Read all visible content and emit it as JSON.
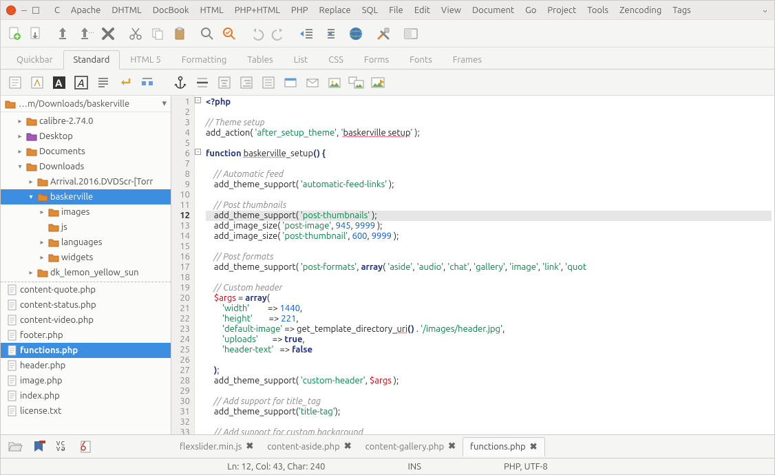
{
  "menu": [
    "C",
    "Apache",
    "DHTML",
    "DocBook",
    "HTML",
    "PHP+HTML",
    "PHP",
    "Replace",
    "SQL",
    "File",
    "Edit",
    "View",
    "Document",
    "Go",
    "Project",
    "Tools",
    "Zencoding",
    "Tags"
  ],
  "toolTabs": [
    "Quickbar",
    "Standard",
    "HTML 5",
    "Formatting",
    "Tables",
    "List",
    "CSS",
    "Forms",
    "Fonts",
    "Frames"
  ],
  "activeToolTab": 1,
  "breadcrumb": "…m/Downloads/baskerville",
  "tree": [
    {
      "label": "calibre-2.74.0",
      "icon": "folder",
      "indent": 1,
      "exp": "▸"
    },
    {
      "label": "Desktop",
      "icon": "folder-p",
      "indent": 1,
      "exp": "▸"
    },
    {
      "label": "Documents",
      "icon": "folder-d",
      "indent": 1,
      "exp": "▸"
    },
    {
      "label": "Downloads",
      "icon": "folder-d",
      "indent": 1,
      "exp": "▾"
    },
    {
      "label": "Arrival.2016.DVDScr-[Torr",
      "icon": "folder",
      "indent": 2,
      "exp": "▸"
    },
    {
      "label": "baskerville",
      "icon": "folder",
      "indent": 2,
      "exp": "▾",
      "sel": true
    },
    {
      "label": "images",
      "icon": "folder",
      "indent": 3,
      "exp": "▸"
    },
    {
      "label": "js",
      "icon": "folder",
      "indent": 3,
      "exp": ""
    },
    {
      "label": "languages",
      "icon": "folder",
      "indent": 3,
      "exp": "▸"
    },
    {
      "label": "widgets",
      "icon": "folder",
      "indent": 3,
      "exp": "▸"
    },
    {
      "label": "dk_lemon_yellow_sun",
      "icon": "folder",
      "indent": 2,
      "exp": "▸"
    }
  ],
  "files": [
    "content-quote.php",
    "content-status.php",
    "content-video.php",
    "footer.php",
    "functions.php",
    "header.php",
    "image.php",
    "index.php",
    "license.txt"
  ],
  "selectedFile": 4,
  "openTabs": [
    {
      "label": "flexslider.min.js",
      "dirty": true
    },
    {
      "label": "content-aside.php",
      "dirty": true
    },
    {
      "label": "content-gallery.php",
      "dirty": true
    },
    {
      "label": "functions.php",
      "dirty": true
    }
  ],
  "activeOpenTab": 3,
  "status": {
    "pos": "Ln: 12, Col: 43, Char: 240",
    "ins": "INS",
    "mode": "PHP, UTF-8"
  },
  "lines": 33,
  "currentLine": 12,
  "code": [
    {
      "t": [
        [
          "k",
          "<?php"
        ]
      ]
    },
    {
      "t": []
    },
    {
      "t": [
        [
          "c",
          "// Theme setup"
        ]
      ]
    },
    {
      "t": [
        [
          "p",
          "add_action("
        ],
        [
          "p",
          " "
        ],
        [
          "s",
          "'after_setup_theme'"
        ],
        [
          "p",
          ", "
        ],
        [
          "s",
          "'"
        ],
        [
          "f",
          "baskerville setup"
        ],
        [
          "s",
          "'"
        ],
        [
          "p",
          " );"
        ]
      ]
    },
    {
      "t": []
    },
    {
      "t": [
        [
          "k",
          "function"
        ],
        [
          "p",
          " "
        ],
        [
          "f",
          "baskerville"
        ],
        [
          "p",
          "_setup"
        ],
        [
          "k",
          "()"
        ],
        [
          "p",
          " "
        ],
        [
          "k",
          "{"
        ]
      ]
    },
    {
      "t": []
    },
    {
      "t": [
        [
          "p",
          "    "
        ],
        [
          "c",
          "// Automatic feed"
        ]
      ]
    },
    {
      "t": [
        [
          "p",
          "    add_theme_support( "
        ],
        [
          "s",
          "'automatic-feed-links'"
        ],
        [
          "p",
          " );"
        ]
      ]
    },
    {
      "t": []
    },
    {
      "t": [
        [
          "p",
          "    "
        ],
        [
          "c",
          "// Post thumbnails"
        ]
      ]
    },
    {
      "t": [
        [
          "p",
          "    add_theme_support( "
        ],
        [
          "s",
          "'post-thumbnails'"
        ],
        [
          "p",
          " );"
        ]
      ],
      "hl": true
    },
    {
      "t": [
        [
          "p",
          "    add_image_size( "
        ],
        [
          "s",
          "'post-image'"
        ],
        [
          "p",
          ", "
        ],
        [
          "n",
          "945"
        ],
        [
          "p",
          ", "
        ],
        [
          "n",
          "9999"
        ],
        [
          "p",
          " );"
        ]
      ]
    },
    {
      "t": [
        [
          "p",
          "    add_image_size( "
        ],
        [
          "s",
          "'post-thumbnail'"
        ],
        [
          "p",
          ", "
        ],
        [
          "n",
          "600"
        ],
        [
          "p",
          ", "
        ],
        [
          "n",
          "9999"
        ],
        [
          "p",
          " );"
        ]
      ]
    },
    {
      "t": []
    },
    {
      "t": [
        [
          "p",
          "    "
        ],
        [
          "c",
          "// Post formats"
        ]
      ]
    },
    {
      "t": [
        [
          "p",
          "    add_theme_support( "
        ],
        [
          "s",
          "'post-formats'"
        ],
        [
          "p",
          ", "
        ],
        [
          "k",
          "array"
        ],
        [
          "p",
          "( "
        ],
        [
          "s",
          "'aside'"
        ],
        [
          "p",
          ", "
        ],
        [
          "s",
          "'audio'"
        ],
        [
          "p",
          ", "
        ],
        [
          "s",
          "'chat'"
        ],
        [
          "p",
          ", "
        ],
        [
          "s",
          "'gallery'"
        ],
        [
          "p",
          ", "
        ],
        [
          "s",
          "'image'"
        ],
        [
          "p",
          ", "
        ],
        [
          "s",
          "'link'"
        ],
        [
          "p",
          ", "
        ],
        [
          "s",
          "'quot"
        ]
      ]
    },
    {
      "t": []
    },
    {
      "t": [
        [
          "p",
          "    "
        ],
        [
          "c",
          "// Custom header"
        ]
      ]
    },
    {
      "t": [
        [
          "p",
          "    "
        ],
        [
          "v",
          "$args"
        ],
        [
          "p",
          " = "
        ],
        [
          "k",
          "array"
        ],
        [
          "p",
          "("
        ]
      ]
    },
    {
      "t": [
        [
          "p",
          "        "
        ],
        [
          "s",
          "'width'"
        ],
        [
          "p",
          "         => "
        ],
        [
          "n",
          "1440"
        ],
        [
          "p",
          ","
        ]
      ]
    },
    {
      "t": [
        [
          "p",
          "        "
        ],
        [
          "s",
          "'height'"
        ],
        [
          "p",
          "        => "
        ],
        [
          "n",
          "221"
        ],
        [
          "p",
          ","
        ]
      ]
    },
    {
      "t": [
        [
          "p",
          "        "
        ],
        [
          "s",
          "'default-image'"
        ],
        [
          "p",
          " => get_template_directory_"
        ],
        [
          "f",
          "uri"
        ],
        [
          "k",
          "()"
        ],
        [
          "p",
          " . "
        ],
        [
          "s",
          "'/images/header.jpg'"
        ],
        [
          "p",
          ","
        ]
      ]
    },
    {
      "t": [
        [
          "p",
          "        "
        ],
        [
          "s",
          "'uploads'"
        ],
        [
          "p",
          "       => "
        ],
        [
          "k",
          "true"
        ],
        [
          "p",
          ","
        ]
      ]
    },
    {
      "t": [
        [
          "p",
          "        "
        ],
        [
          "s",
          "'header-text'"
        ],
        [
          "p",
          "   => "
        ],
        [
          "k",
          "false"
        ]
      ]
    },
    {
      "t": []
    },
    {
      "t": [
        [
          "p",
          "    "
        ],
        [
          "k",
          ")"
        ],
        [
          "p",
          ";"
        ]
      ]
    },
    {
      "t": [
        [
          "p",
          "    add_theme_support( "
        ],
        [
          "s",
          "'custom-header'"
        ],
        [
          "p",
          ", "
        ],
        [
          "v",
          "$args"
        ],
        [
          "p",
          " );"
        ]
      ]
    },
    {
      "t": []
    },
    {
      "t": [
        [
          "p",
          "    "
        ],
        [
          "c",
          "// Add support for title_tag"
        ]
      ]
    },
    {
      "t": [
        [
          "p",
          "    add_theme_support("
        ],
        [
          "s",
          "'title-tag'"
        ],
        [
          "p",
          ");"
        ]
      ]
    },
    {
      "t": []
    },
    {
      "t": [
        [
          "p",
          "    "
        ],
        [
          "c",
          "// Add support for custom background"
        ]
      ]
    }
  ]
}
